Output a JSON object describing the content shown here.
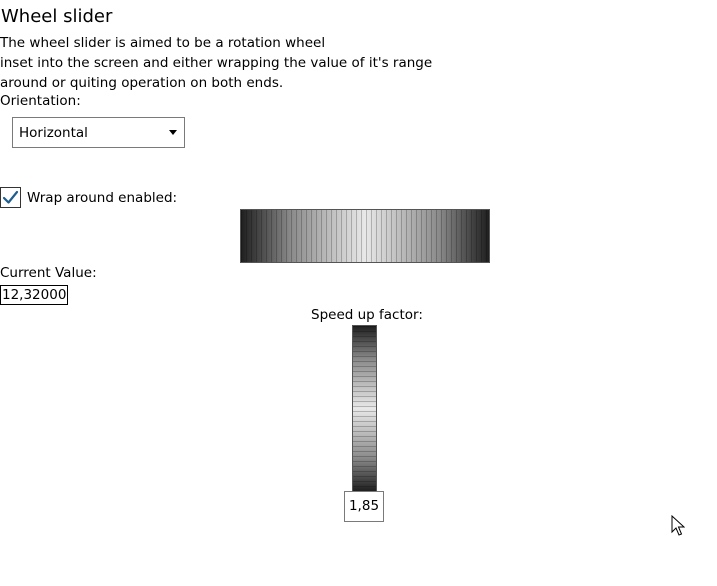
{
  "page": {
    "title": "Wheel slider",
    "description_lines": [
      "The wheel slider is aimed to be a rotation wheel",
      "inset into the screen and either wrapping the value of it's range",
      "around or quiting operation on both ends."
    ]
  },
  "orientation": {
    "label": "Orientation:",
    "selected": "Horizontal"
  },
  "wrap_around": {
    "label": "Wrap around enabled:",
    "checked": true
  },
  "current_value": {
    "label": "Current Value:",
    "value": "12,320000"
  },
  "speed_up": {
    "label": "Speed up factor:",
    "value": "1,85"
  },
  "colors": {
    "checkmark": "#1e5e8f",
    "wheel_dark": "#1f1f1f",
    "wheel_light": "#e8e8e8"
  }
}
